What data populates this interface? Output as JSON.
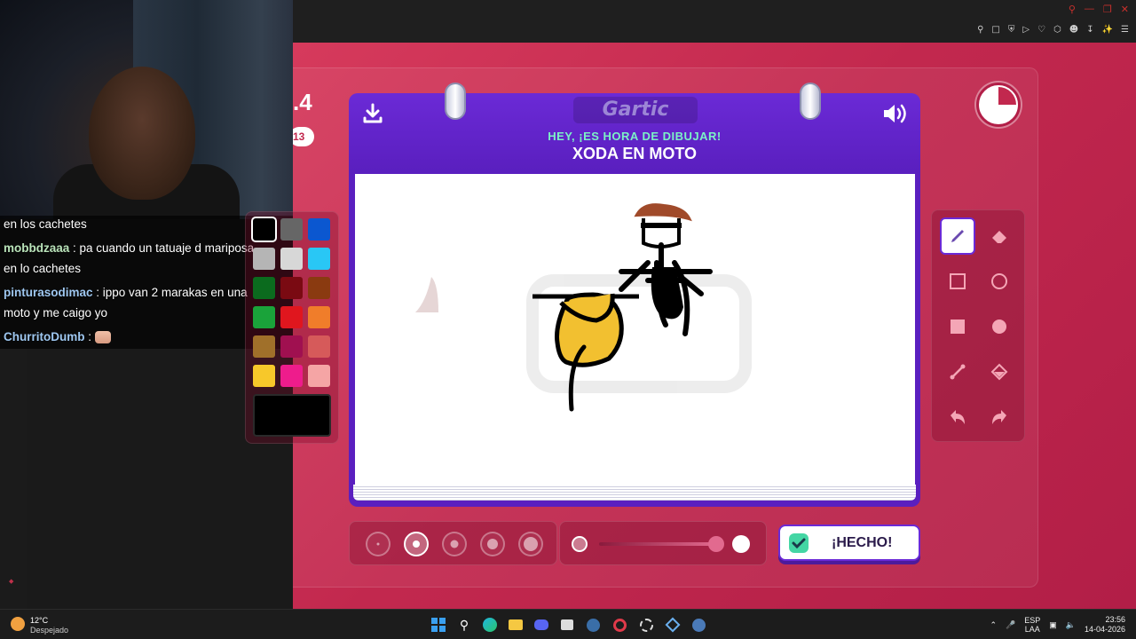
{
  "header": {
    "logo": "Gartic",
    "prompt_intro": "HEY, ¡ES HORA DE DIBUJAR!",
    "prompt_word": "XODA EN MOTO"
  },
  "left_panel": {
    "score_partial": ".4",
    "badge_partial": "13"
  },
  "chat": {
    "messages": [
      {
        "user": "",
        "text": "en los cachetes"
      },
      {
        "user": "mobbdzaaa",
        "text": " : pa cuando un tatuaje d mariposa"
      },
      {
        "user": "",
        "text": "en lo cachetes"
      },
      {
        "user": "pinturasodimac",
        "text": " : ippo van 2 marakas en una"
      },
      {
        "user": "",
        "text": "moto y me caigo yo"
      },
      {
        "user": "ChurritoDumb",
        "text": " : "
      }
    ]
  },
  "palette": {
    "colors": [
      "#000000",
      "#666666",
      "#0b57d0",
      "#b5b5b5",
      "#d7d7d7",
      "#29c7f5",
      "#0b6b1e",
      "#7a0a12",
      "#8a3a10",
      "#1aa33a",
      "#e0161e",
      "#f07d2a",
      "#a0702a",
      "#a01050",
      "#d65a5a",
      "#f7c82a",
      "#ee1c8c",
      "#f5a5a5"
    ],
    "selected": "#000000"
  },
  "tools": {
    "items": [
      "pencil-icon",
      "eraser-icon",
      "square-outline-icon",
      "circle-outline-icon",
      "square-filled-icon",
      "circle-filled-icon",
      "line-icon",
      "fill-bucket-icon",
      "undo-icon",
      "redo-icon"
    ],
    "selected": "pencil-icon"
  },
  "brush_sizes": {
    "count": 5,
    "selected_index": 1
  },
  "opacity": {
    "value": 1.0
  },
  "timer": {
    "remaining_fraction": 0.75
  },
  "done_button": {
    "label": "¡HECHO!"
  },
  "taskbar": {
    "weather_temp": "12°C",
    "weather_desc": "Despejado",
    "lang_1": "ESP",
    "lang_2": "LAA",
    "time": "23:56",
    "date": "14-04-2026"
  },
  "colors": {
    "accent": "#6b2ad6",
    "game_bg": "#c2284e",
    "prompt_intro": "#7cf2c6"
  }
}
